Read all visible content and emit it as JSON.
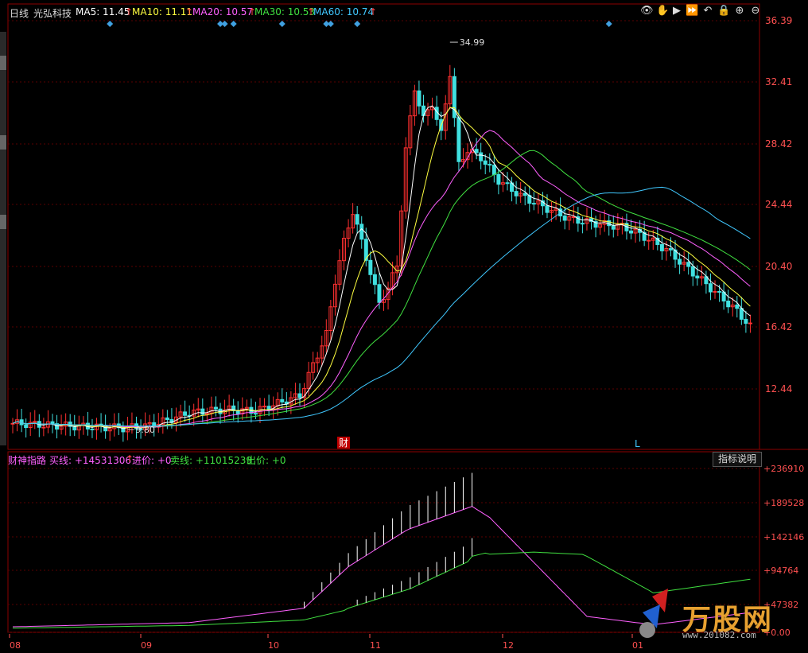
{
  "header": {
    "period": "日线",
    "stock_name": "光弘科技",
    "ma": [
      {
        "label": "MA5: 11.45",
        "color": "#ffffff"
      },
      {
        "label": "MA10: 11.11",
        "color": "#ffff40"
      },
      {
        "label": "MA20: 10.57",
        "color": "#ff60ff"
      },
      {
        "label": "MA30: 10.53",
        "color": "#40e040"
      },
      {
        "label": "MA60: 10.74",
        "color": "#40c8ff"
      }
    ],
    "ma_up_arrow": "↑"
  },
  "toolbar_icons": [
    "eye-icon",
    "hand-icon",
    "play-icon",
    "fast-forward-icon",
    "undo-icon",
    "lock-icon",
    "zoom-in-icon",
    "zoom-out-icon"
  ],
  "price_axis": {
    "labels": [
      "36.39",
      "32.41",
      "28.42",
      "24.44",
      "20.40",
      "16.42",
      "12.44"
    ]
  },
  "annotations": {
    "high": "34.99",
    "low": "9.80",
    "cai_marker": "财",
    "l_marker": "L"
  },
  "indicator": {
    "name": "财神指路",
    "buy_label": "买线: +14531306",
    "in_label": "进价: +0",
    "sell_label": "卖线: +11015239",
    "out_label": "出价: +0",
    "legend_button": "指标说明",
    "axis_labels": [
      "+236910",
      "+189528",
      "+142146",
      "+94764",
      "+47382",
      "+0.00"
    ]
  },
  "x_axis": {
    "labels": [
      "08",
      "09",
      "10",
      "11",
      "12",
      "01"
    ]
  },
  "watermark": {
    "logo": "万股网",
    "url": "www.201082.com"
  },
  "chart_data": {
    "type": "candlestick",
    "price_range": [
      9.0,
      37.0
    ],
    "days": 120,
    "indicator_range": [
      0,
      250000
    ]
  }
}
